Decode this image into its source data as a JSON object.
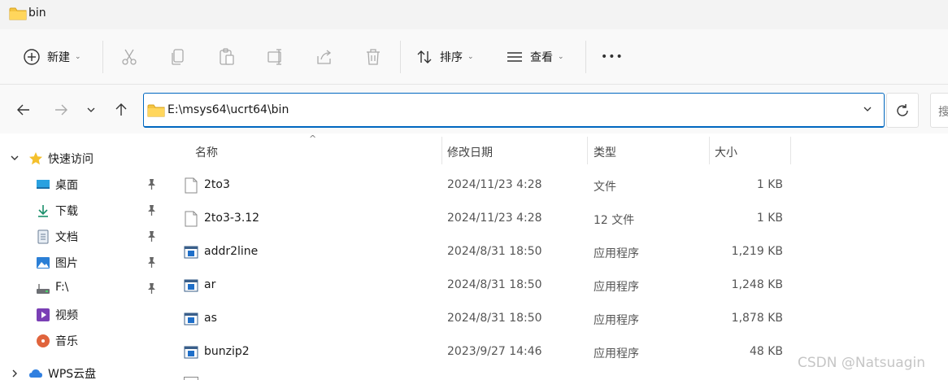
{
  "window": {
    "title": "bin"
  },
  "toolbar": {
    "new_label": "新建",
    "sort_label": "排序",
    "view_label": "查看",
    "more_label": "•••"
  },
  "address": {
    "path": "E:\\msys64\\ucrt64\\bin",
    "search_placeholder": "搜"
  },
  "sidebar": {
    "quick_access": "快速访问",
    "items": [
      {
        "label": "桌面",
        "icon": "desktop-icon",
        "pinned": true
      },
      {
        "label": "下载",
        "icon": "download-icon",
        "pinned": true
      },
      {
        "label": "文档",
        "icon": "document-icon",
        "pinned": true
      },
      {
        "label": "图片",
        "icon": "pictures-icon",
        "pinned": true
      },
      {
        "label": "F:\\",
        "icon": "drive-icon",
        "pinned": true
      },
      {
        "label": "视频",
        "icon": "video-icon",
        "pinned": false
      },
      {
        "label": "音乐",
        "icon": "music-icon",
        "pinned": false
      }
    ],
    "wps": "WPS云盘"
  },
  "columns": {
    "name": "名称",
    "date": "修改日期",
    "type": "类型",
    "size": "大小"
  },
  "files": [
    {
      "name": "2to3",
      "date": "2024/11/23 4:28",
      "type": "文件",
      "size": "1 KB",
      "icon": "file-icon"
    },
    {
      "name": "2to3-3.12",
      "date": "2024/11/23 4:28",
      "type": "12 文件",
      "size": "1 KB",
      "icon": "file-icon"
    },
    {
      "name": "addr2line",
      "date": "2024/8/31 18:50",
      "type": "应用程序",
      "size": "1,219 KB",
      "icon": "app-icon"
    },
    {
      "name": "ar",
      "date": "2024/8/31 18:50",
      "type": "应用程序",
      "size": "1,248 KB",
      "icon": "app-icon"
    },
    {
      "name": "as",
      "date": "2024/8/31 18:50",
      "type": "应用程序",
      "size": "1,878 KB",
      "icon": "app-icon"
    },
    {
      "name": "bunzip2",
      "date": "2023/9/27 14:46",
      "type": "应用程序",
      "size": "48 KB",
      "icon": "app-icon"
    }
  ],
  "watermark": "CSDN @Natsuagin",
  "colors": {
    "accent": "#0067c0",
    "folder": "#f4c441",
    "app_icon": "#1f6fc9"
  }
}
